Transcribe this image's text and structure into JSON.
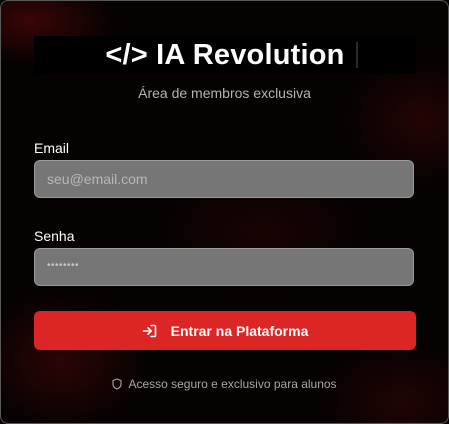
{
  "brand": {
    "logo_text": "</> IA Revolution",
    "subtitle": "Área de membros exclusiva"
  },
  "form": {
    "email_label": "Email",
    "email_placeholder": "seu@email.com",
    "password_label": "Senha",
    "password_value": "••••••••",
    "submit_label": "Entrar na Plataforma",
    "submit_icon": "login-arrow-icon"
  },
  "footer": {
    "icon": "shield-icon",
    "text": "Acesso seguro e exclusivo para alunos"
  },
  "colors": {
    "accent": "#dc2626",
    "background": "#070202",
    "input_bg": "#767676"
  }
}
